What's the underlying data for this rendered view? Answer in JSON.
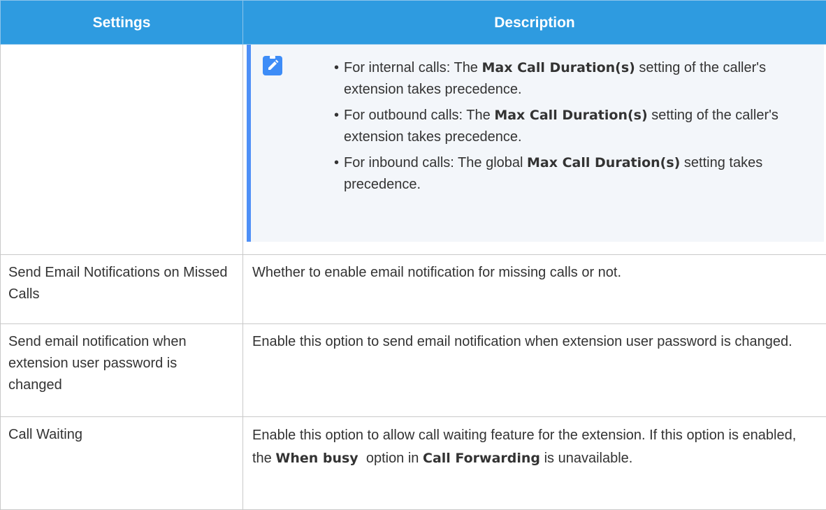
{
  "table": {
    "headers": {
      "settings": "Settings",
      "description": "Description"
    }
  },
  "note": {
    "items": [
      {
        "pre": "For internal calls: The ",
        "bold": "Max Call Duration(s)",
        "post": " setting of the caller's extension takes precedence."
      },
      {
        "pre": "For outbound calls: The ",
        "bold": "Max Call Duration(s)",
        "post": " setting of the caller's extension takes precedence."
      },
      {
        "pre": "For inbound calls: The global ",
        "bold": "Max Call Duration(s)",
        "post": " setting takes precedence."
      }
    ]
  },
  "rows": {
    "email_missed": {
      "setting": "Send Email Notifications on Missed Calls",
      "description": "Whether to enable email notification for missing calls or not."
    },
    "email_password": {
      "setting": "Send email notification when extension user password is changed",
      "description": "Enable this option to send email notification when extension user password is changed."
    },
    "call_waiting": {
      "setting": "Call Waiting",
      "desc_pre": "Enable this option to allow call waiting feature for the extension. If this option is enabled, the ",
      "desc_bold1": "When busy",
      "desc_mid": "  option in ",
      "desc_bold2": "Call Forwarding",
      "desc_post": " is unavailable."
    }
  },
  "colors": {
    "header_bg": "#2e9be0",
    "note_accent": "#4d8ff7",
    "note_bg": "#f3f6fa"
  },
  "icons": {
    "note": "pencil-note-icon"
  }
}
